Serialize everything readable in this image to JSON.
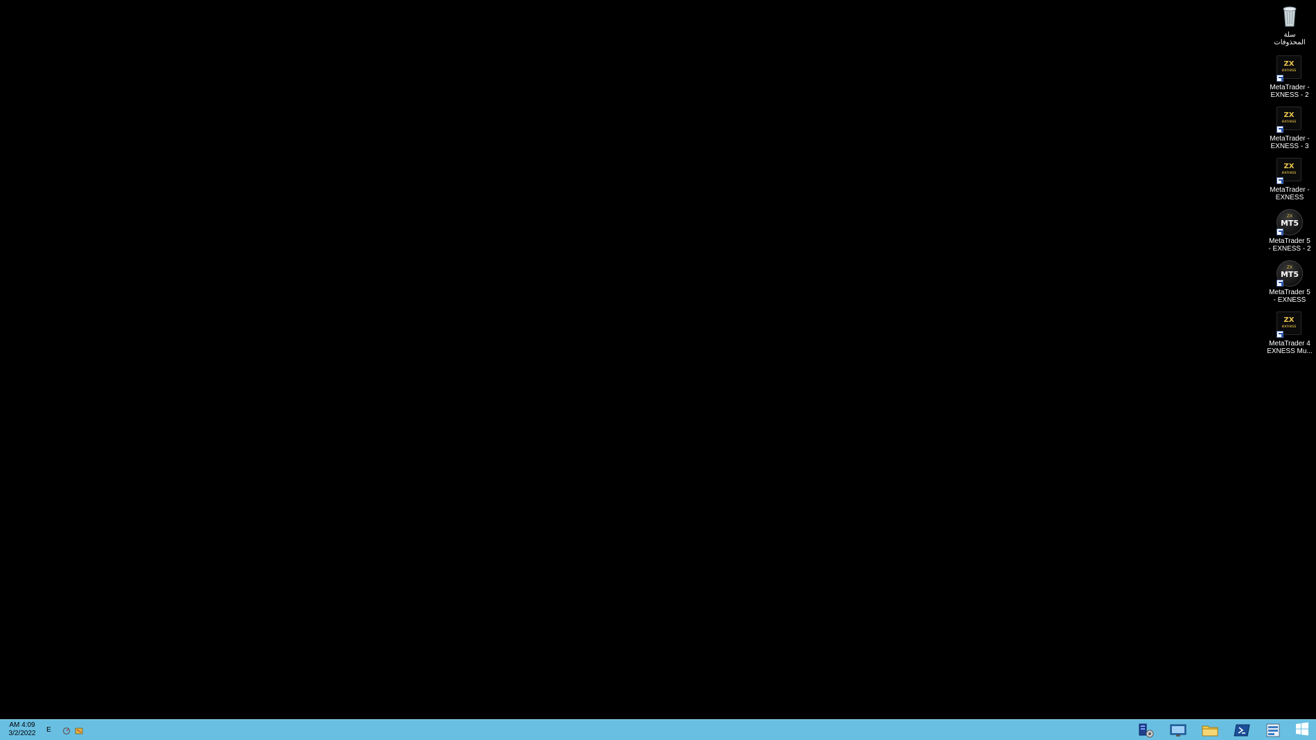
{
  "desktop": {
    "icons": [
      {
        "label": "سلة\nالمحذوفات",
        "type": "recycle-bin"
      },
      {
        "label": "MetaTrader -\nEXNESS - 2",
        "type": "exness"
      },
      {
        "label": "MetaTrader -\nEXNESS - 3",
        "type": "exness"
      },
      {
        "label": "MetaTrader -\nEXNESS",
        "type": "exness"
      },
      {
        "label": "MetaTrader 5\n- EXNESS - 2",
        "type": "mt5"
      },
      {
        "label": "MetaTrader 5\n- EXNESS",
        "type": "mt5"
      },
      {
        "label": "MetaTrader 4\nEXNESS Mu...",
        "type": "exness"
      }
    ],
    "exness_logo_text": "exness",
    "mt5_logo_text": "MT5"
  },
  "taskbar": {
    "time": "AM 4:09",
    "date": "3/2/2022",
    "language": "E",
    "pinned": [
      "server-manager-icon",
      "remote-desktop-icon",
      "file-explorer-icon",
      "powershell-icon",
      "task-manager-icon"
    ],
    "start": "windows-logo-icon"
  },
  "colors": {
    "taskbar": "#69bfe2",
    "desktop": "#000000",
    "exness_gold": "#e8c24a"
  }
}
